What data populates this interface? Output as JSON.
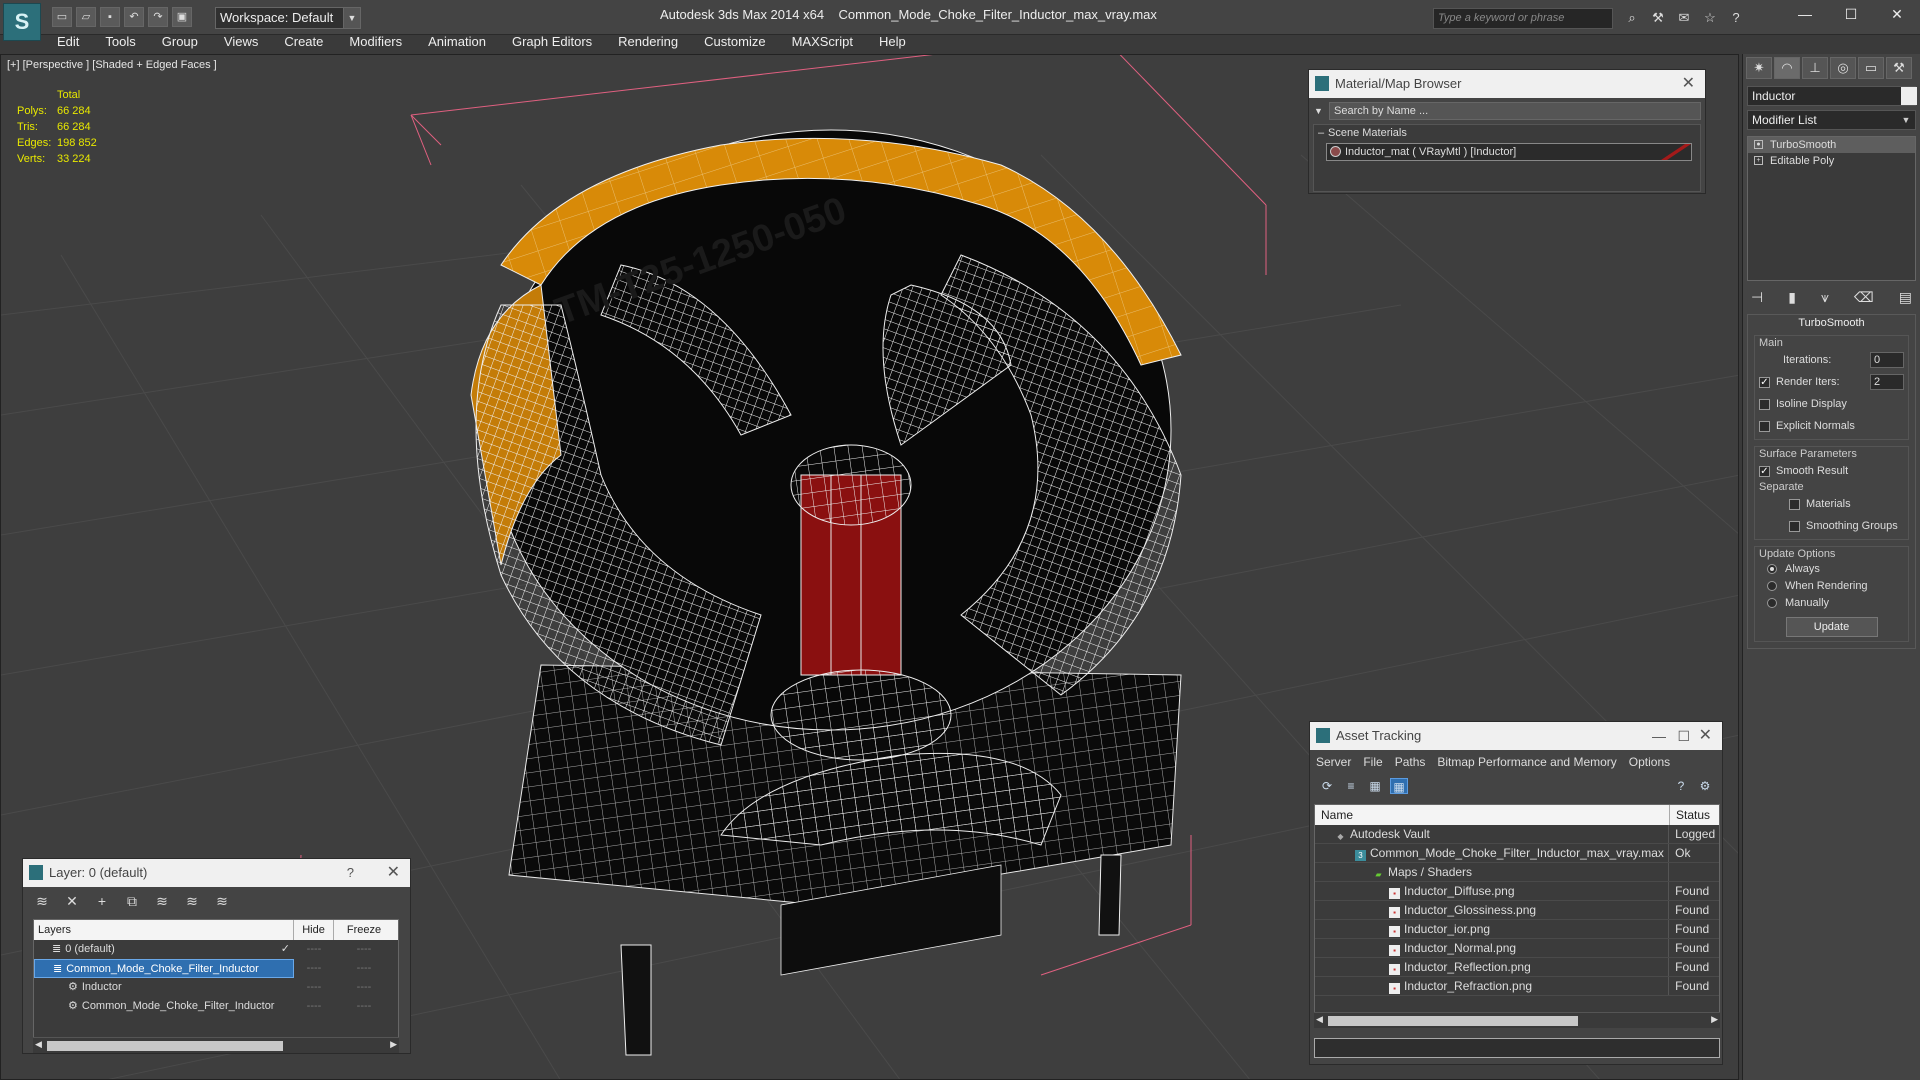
{
  "window": {
    "app_title": "Autodesk 3ds Max  2014 x64",
    "file_title": "Common_Mode_Choke_Filter_Inductor_max_vray.max",
    "workspace": "Workspace: Default",
    "search_placeholder": "Type a keyword or phrase"
  },
  "menu": [
    "Edit",
    "Tools",
    "Group",
    "Views",
    "Create",
    "Modifiers",
    "Animation",
    "Graph Editors",
    "Rendering",
    "Customize",
    "MAXScript",
    "Help"
  ],
  "viewport": {
    "label": "[+] [Perspective ] [Shaded + Edged Faces ]",
    "stats_header": "Total",
    "stats": [
      {
        "k": "Polys:",
        "v": "66 284"
      },
      {
        "k": "Tris:",
        "v": "66 284"
      },
      {
        "k": "Edges:",
        "v": "198 852"
      },
      {
        "k": "Verts:",
        "v": "33 224"
      }
    ],
    "model_text": "TM-T25-1250-050"
  },
  "command_panel": {
    "object_name": "Inductor",
    "modifier_list": "Modifier List",
    "stack": [
      "TurboSmooth",
      "Editable Poly"
    ],
    "rollout_title": "TurboSmooth",
    "main_label": "Main",
    "iterations_label": "Iterations:",
    "iterations_value": "0",
    "render_iters_label": "Render Iters:",
    "render_iters_value": "2",
    "isoline_label": "Isoline Display",
    "explicit_normals_label": "Explicit Normals",
    "surface_params_label": "Surface Parameters",
    "smooth_result_label": "Smooth Result",
    "separate_label": "Separate",
    "materials_label": "Materials",
    "smoothing_groups_label": "Smoothing Groups",
    "update_options_label": "Update Options",
    "always_label": "Always",
    "when_rendering_label": "When Rendering",
    "manually_label": "Manually",
    "update_button": "Update"
  },
  "material_browser": {
    "title": "Material/Map Browser",
    "search_placeholder": "Search by Name ...",
    "category": "Scene Materials",
    "material": "Inductor_mat  ( VRayMtl ) [Inductor]"
  },
  "asset_tracking": {
    "title": "Asset Tracking",
    "menu": [
      "Server",
      "File",
      "Paths",
      "Bitmap Performance and Memory",
      "Options"
    ],
    "col_name": "Name",
    "col_status": "Status",
    "rows": [
      {
        "name": "Autodesk Vault",
        "status": "Logged O",
        "indent": 20
      },
      {
        "name": "Common_Mode_Choke_Filter_Inductor_max_vray.max",
        "status": "Ok",
        "indent": 40
      },
      {
        "name": "Maps / Shaders",
        "status": "",
        "indent": 58
      },
      {
        "name": "Inductor_Diffuse.png",
        "status": "Found",
        "indent": 74
      },
      {
        "name": "Inductor_Glossiness.png",
        "status": "Found",
        "indent": 74
      },
      {
        "name": "Inductor_ior.png",
        "status": "Found",
        "indent": 74
      },
      {
        "name": "Inductor_Normal.png",
        "status": "Found",
        "indent": 74
      },
      {
        "name": "Inductor_Reflection.png",
        "status": "Found",
        "indent": 74
      },
      {
        "name": "Inductor_Refraction.png",
        "status": "Found",
        "indent": 74
      }
    ]
  },
  "layers": {
    "title": "Layer: 0 (default)",
    "help": "?",
    "col_layers": "Layers",
    "col_hide": "Hide",
    "col_freeze": "Freeze",
    "rows": [
      {
        "name": "0 (default)",
        "indent": 18
      },
      {
        "name": "Common_Mode_Choke_Filter_Inductor",
        "indent": 18
      },
      {
        "name": "Inductor",
        "indent": 34
      },
      {
        "name": "Common_Mode_Choke_Filter_Inductor",
        "indent": 34
      }
    ]
  },
  "colors": {
    "accent": "#2f6fb0",
    "tape": "#e0960a",
    "stats": "#e8e800",
    "core": "#8a1010"
  }
}
